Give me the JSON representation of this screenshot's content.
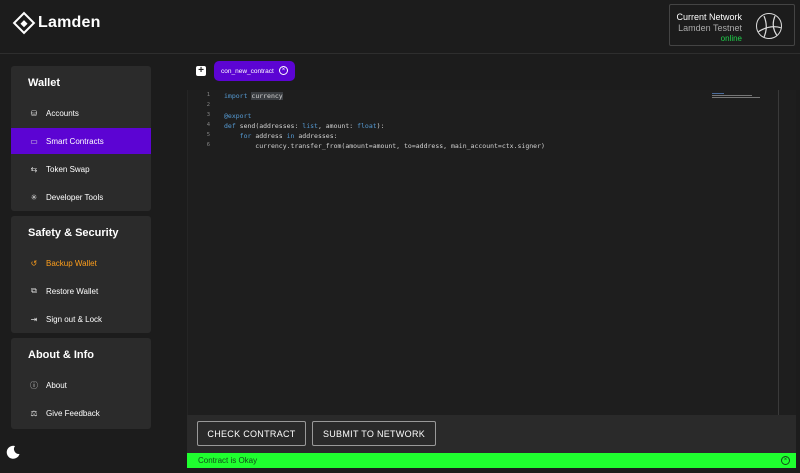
{
  "app": {
    "name": "Lamden"
  },
  "network": {
    "title": "Current Network",
    "name": "Lamden Testnet",
    "status": "online",
    "status_color": "#1fd04a"
  },
  "sidebar": {
    "wallet": {
      "title": "Wallet",
      "items": [
        {
          "label": "Accounts",
          "icon": "wallet-icon"
        },
        {
          "label": "Smart Contracts",
          "icon": "contract-icon",
          "active": true
        },
        {
          "label": "Token Swap",
          "icon": "swap-icon"
        },
        {
          "label": "Developer Tools",
          "icon": "bulb-icon"
        }
      ]
    },
    "security": {
      "title": "Safety & Security",
      "items": [
        {
          "label": "Backup Wallet",
          "icon": "backup-icon",
          "highlight": true
        },
        {
          "label": "Restore Wallet",
          "icon": "restore-icon"
        },
        {
          "label": "Sign out & Lock",
          "icon": "signout-icon"
        }
      ]
    },
    "about": {
      "title": "About & Info",
      "items": [
        {
          "label": "About",
          "icon": "info-icon"
        },
        {
          "label": "Give Feedback",
          "icon": "feedback-icon"
        }
      ]
    }
  },
  "editor": {
    "tab_label": "con_new_contract",
    "line_numbers": [
      "1",
      "2",
      "3",
      "4",
      "5",
      "6"
    ],
    "lines": [
      "import currency",
      "",
      "@export",
      "def send(addresses: list, amount: float):",
      "    for address in addresses:",
      "        currency.transfer_from(amount=amount, to=address, main_account=ctx.signer)"
    ]
  },
  "actions": {
    "check_label": "CHECK CONTRACT",
    "submit_label": "SUBMIT TO NETWORK"
  },
  "status": {
    "message": "Contract is Okay",
    "color": "#1fff2f"
  },
  "colors": {
    "accent": "#5c04d3",
    "highlight": "#ff9f1c",
    "background": "#1c1c1c",
    "panel": "#2b2b2b"
  }
}
